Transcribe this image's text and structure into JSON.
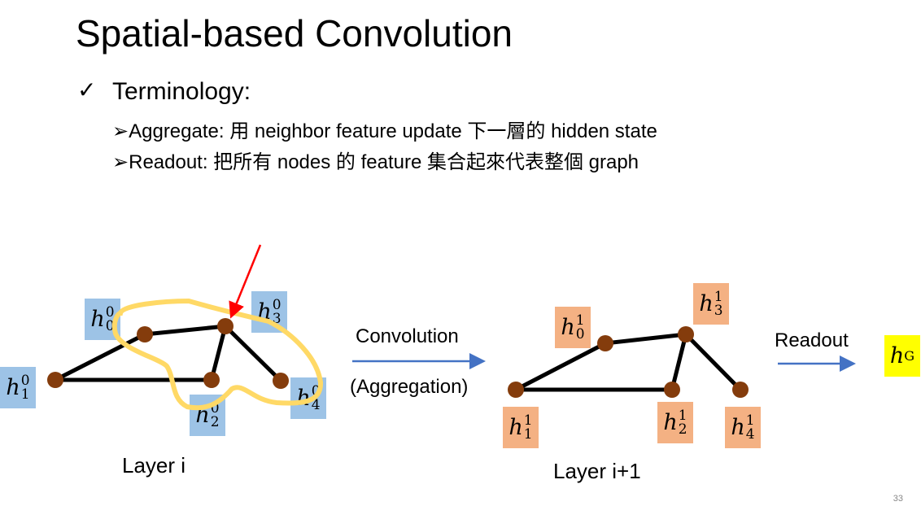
{
  "title": "Spatial-based Convolution",
  "bullet": {
    "icon": "checkmark-icon",
    "check": "✓",
    "label": "Terminology:"
  },
  "subitems": [
    {
      "marker": "➢",
      "text": "Aggregate: 用 neighbor feature update 下一層的 hidden state"
    },
    {
      "marker": "➢",
      "text": "Readout: 把所有 nodes 的 feature 集合起來代表整個 graph"
    }
  ],
  "layer_i": {
    "caption": "Layer i",
    "labels": [
      {
        "base": "h",
        "sup": "0",
        "sub": "0"
      },
      {
        "base": "h",
        "sup": "0",
        "sub": "1"
      },
      {
        "base": "h",
        "sup": "0",
        "sub": "2"
      },
      {
        "base": "h",
        "sup": "0",
        "sub": "3"
      },
      {
        "base": "h",
        "sup": "0",
        "sub": "4"
      }
    ]
  },
  "layer_i1": {
    "caption": "Layer i+1",
    "labels": [
      {
        "base": "h",
        "sup": "1",
        "sub": "0"
      },
      {
        "base": "h",
        "sup": "1",
        "sub": "1"
      },
      {
        "base": "h",
        "sup": "1",
        "sub": "2"
      },
      {
        "base": "h",
        "sup": "1",
        "sub": "3"
      },
      {
        "base": "h",
        "sup": "1",
        "sub": "4"
      }
    ]
  },
  "convolution": {
    "top": "Convolution",
    "bottom": "(Aggregation)"
  },
  "readout": {
    "label": "Readout"
  },
  "graph_output": {
    "base": "h",
    "sub": "G"
  },
  "colors": {
    "layer_i": "#9dc3e6",
    "layer_i1": "#f4b183",
    "output": "#ffff00",
    "node": "#843c0c",
    "arrow": "#4472c4",
    "highlight": "#ffd966",
    "pointer": "#ff0000"
  },
  "page_number": "33"
}
